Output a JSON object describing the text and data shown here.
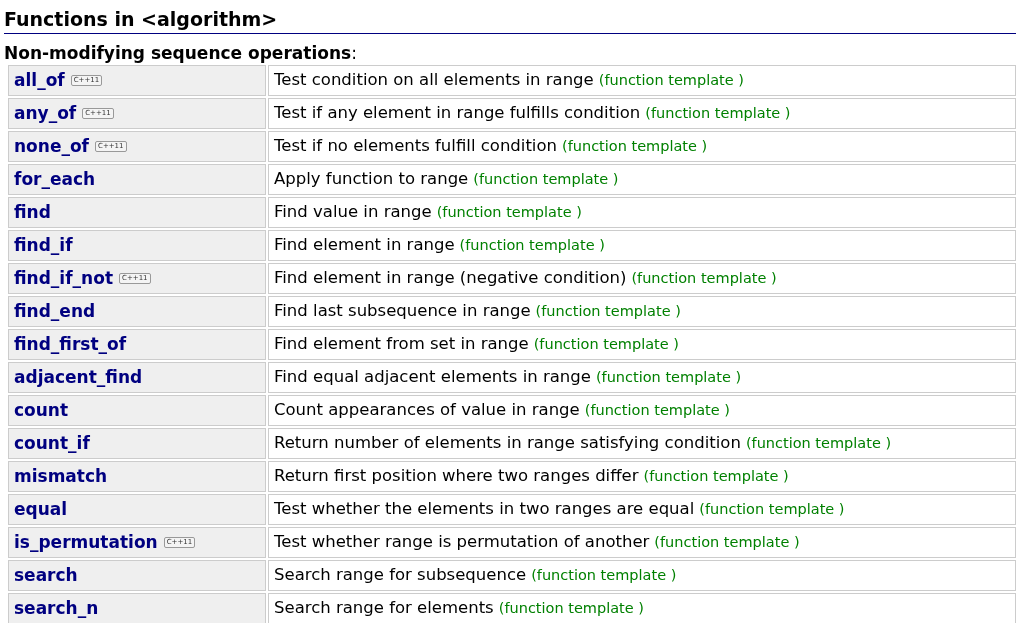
{
  "title": "Functions in <algorithm>",
  "section": {
    "heading": "Non-modifying sequence operations",
    "heading_suffix": ":"
  },
  "rows": [
    {
      "name": "all_of",
      "badge": "C++11",
      "description": "Test condition on all elements in range",
      "kind_label": "(function template )"
    },
    {
      "name": "any_of",
      "badge": "C++11",
      "description": "Test if any element in range fulfills condition",
      "kind_label": "(function template )"
    },
    {
      "name": "none_of",
      "badge": "C++11",
      "description": "Test if no elements fulfill condition",
      "kind_label": "(function template )"
    },
    {
      "name": "for_each",
      "description": "Apply function to range",
      "kind_label": "(function template )"
    },
    {
      "name": "find",
      "description": "Find value in range",
      "kind_label": "(function template )"
    },
    {
      "name": "find_if",
      "description": "Find element in range",
      "kind_label": "(function template )"
    },
    {
      "name": "find_if_not",
      "badge": "C++11",
      "description": "Find element in range (negative condition)",
      "kind_label": "(function template )"
    },
    {
      "name": "find_end",
      "description": "Find last subsequence in range",
      "kind_label": "(function template )"
    },
    {
      "name": "find_first_of",
      "description": "Find element from set in range",
      "kind_label": "(function template )"
    },
    {
      "name": "adjacent_find",
      "description": "Find equal adjacent elements in range",
      "kind_label": "(function template )"
    },
    {
      "name": "count",
      "description": "Count appearances of value in range",
      "kind_label": "(function template )"
    },
    {
      "name": "count_if",
      "description": "Return number of elements in range satisfying condition",
      "kind_label": "(function template )"
    },
    {
      "name": "mismatch",
      "description": "Return first position where two ranges differ",
      "kind_label": "(function template )"
    },
    {
      "name": "equal",
      "description": "Test whether the elements in two ranges are equal",
      "kind_label": "(function template )"
    },
    {
      "name": "is_permutation",
      "badge": "C++11",
      "description": "Test whether range is permutation of another",
      "kind_label": "(function template )"
    },
    {
      "name": "search",
      "description": "Search range for subsequence",
      "kind_label": "(function template )"
    },
    {
      "name": "search_n",
      "description": "Search range for elements",
      "kind_label": "(function template )"
    }
  ]
}
